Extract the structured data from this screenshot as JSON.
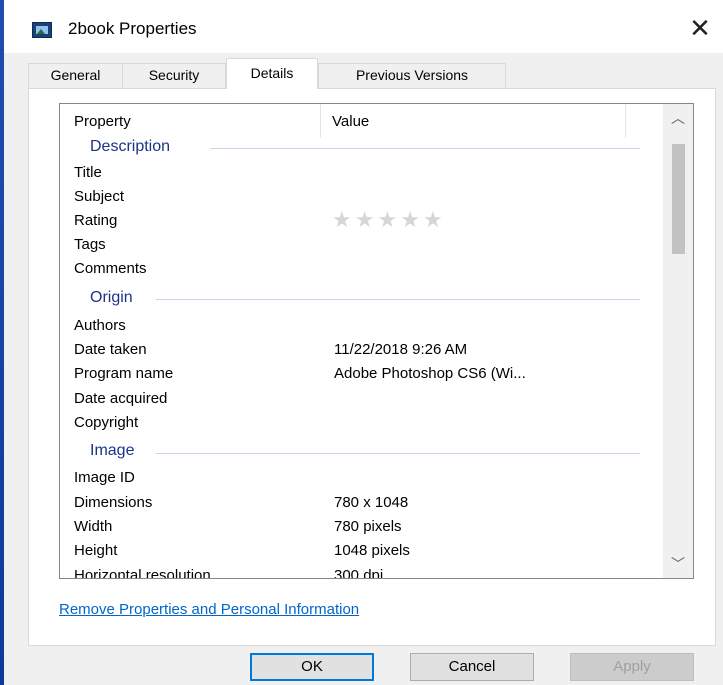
{
  "window": {
    "title": "2book Properties",
    "close_glyph": "✕"
  },
  "tabs": [
    {
      "label": "General",
      "active": false
    },
    {
      "label": "Security",
      "active": false
    },
    {
      "label": "Details",
      "active": true
    },
    {
      "label": "Previous Versions",
      "active": false
    }
  ],
  "details": {
    "columns": {
      "property": "Property",
      "value": "Value"
    },
    "groups": {
      "description": "Description",
      "origin": "Origin",
      "image": "Image"
    },
    "rows": {
      "title": {
        "name": "Title",
        "value": ""
      },
      "subject": {
        "name": "Subject",
        "value": ""
      },
      "rating": {
        "name": "Rating",
        "stars": 0,
        "max_stars": 5
      },
      "tags": {
        "name": "Tags",
        "value": ""
      },
      "comments": {
        "name": "Comments",
        "value": ""
      },
      "authors": {
        "name": "Authors",
        "value": ""
      },
      "date_taken": {
        "name": "Date taken",
        "value": "11/22/2018 9:26 AM"
      },
      "program_name": {
        "name": "Program name",
        "value": "Adobe Photoshop CS6 (Wi..."
      },
      "date_acquired": {
        "name": "Date acquired",
        "value": ""
      },
      "copyright": {
        "name": "Copyright",
        "value": ""
      },
      "image_id": {
        "name": "Image ID",
        "value": ""
      },
      "dimensions": {
        "name": "Dimensions",
        "value": "780 x 1048"
      },
      "width": {
        "name": "Width",
        "value": "780 pixels"
      },
      "height": {
        "name": "Height",
        "value": "1048 pixels"
      },
      "horizontal_resolution": {
        "name": "Horizontal resolution",
        "value": "300 dpi"
      }
    },
    "scroll_icons": {
      "up": "chevron-up-icon",
      "down": "chevron-down-icon"
    }
  },
  "link": {
    "remove": "Remove Properties and Personal Information"
  },
  "buttons": {
    "ok": "OK",
    "cancel": "Cancel",
    "apply": "Apply"
  },
  "colors": {
    "group_header": "#1e3287",
    "link": "#0066cc",
    "default_button_border": "#0078d7",
    "star_empty": "#d6d6d6"
  }
}
